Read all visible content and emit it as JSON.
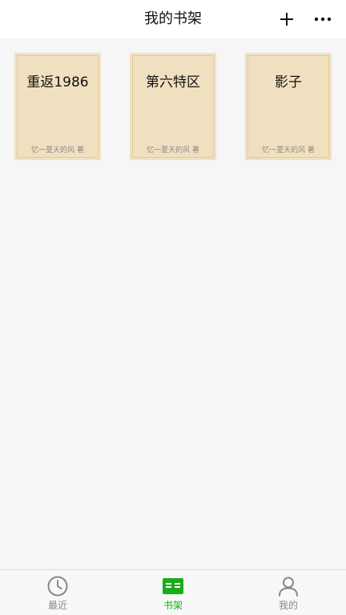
{
  "header": {
    "title": "我的书架",
    "add_icon": "plus-icon",
    "more_icon": "more-dots-icon"
  },
  "books": [
    {
      "title": "重返1986",
      "author": "忆一夏天的风 著"
    },
    {
      "title": "第六特区",
      "author": "忆一夏天的风 著"
    },
    {
      "title": "影子",
      "author": "忆一夏天的风 著"
    }
  ],
  "tabbar": {
    "tabs": [
      {
        "label": "最近",
        "icon": "clock-icon",
        "active": false
      },
      {
        "label": "书架",
        "icon": "book-icon",
        "active": true
      },
      {
        "label": "我的",
        "icon": "user-icon",
        "active": false
      }
    ]
  },
  "colors": {
    "accent": "#1aad19",
    "cover": "#f1e0c0",
    "cover_border": "#e1c99d",
    "inactive_tab": "#888888"
  }
}
